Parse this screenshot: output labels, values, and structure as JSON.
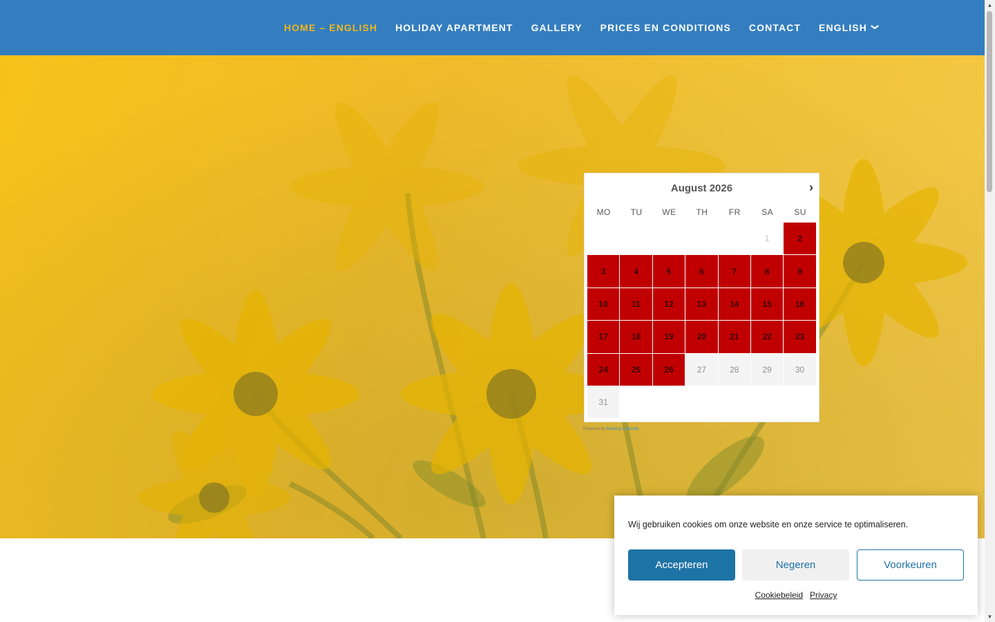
{
  "nav": {
    "items": [
      {
        "label": "HOME – ENGLISH",
        "active": true
      },
      {
        "label": "HOLIDAY APARTMENT",
        "active": false
      },
      {
        "label": "GALLERY",
        "active": false
      },
      {
        "label": "PRICES EN CONDITIONS",
        "active": false
      },
      {
        "label": "CONTACT",
        "active": false
      },
      {
        "label": "ENGLISH",
        "active": false,
        "dropdown": true
      }
    ]
  },
  "calendar": {
    "title": "August 2026",
    "next_icon": "chevron-right-icon",
    "weekdays": [
      "MO",
      "TU",
      "WE",
      "TH",
      "FR",
      "SA",
      "SU"
    ],
    "leading_blanks": 5,
    "days": [
      {
        "d": "1",
        "status": "past"
      },
      {
        "d": "2",
        "status": "booked"
      },
      {
        "d": "3",
        "status": "booked"
      },
      {
        "d": "4",
        "status": "booked"
      },
      {
        "d": "5",
        "status": "booked"
      },
      {
        "d": "6",
        "status": "booked"
      },
      {
        "d": "7",
        "status": "booked"
      },
      {
        "d": "8",
        "status": "booked"
      },
      {
        "d": "9",
        "status": "booked"
      },
      {
        "d": "10",
        "status": "booked"
      },
      {
        "d": "11",
        "status": "booked"
      },
      {
        "d": "12",
        "status": "booked"
      },
      {
        "d": "13",
        "status": "booked"
      },
      {
        "d": "14",
        "status": "booked"
      },
      {
        "d": "15",
        "status": "booked"
      },
      {
        "d": "16",
        "status": "booked"
      },
      {
        "d": "17",
        "status": "booked"
      },
      {
        "d": "18",
        "status": "booked"
      },
      {
        "d": "19",
        "status": "booked"
      },
      {
        "d": "20",
        "status": "booked"
      },
      {
        "d": "21",
        "status": "booked"
      },
      {
        "d": "22",
        "status": "booked"
      },
      {
        "d": "23",
        "status": "booked"
      },
      {
        "d": "24",
        "status": "booked"
      },
      {
        "d": "25",
        "status": "booked"
      },
      {
        "d": "26",
        "status": "booked"
      },
      {
        "d": "27",
        "status": "free"
      },
      {
        "d": "28",
        "status": "free"
      },
      {
        "d": "29",
        "status": "free"
      },
      {
        "d": "30",
        "status": "free"
      },
      {
        "d": "31",
        "status": "free"
      }
    ],
    "powered_prefix": "Powered by ",
    "powered_link": "Booking Calendar"
  },
  "cookie": {
    "message": "Wij gebruiken cookies om onze website en onze service te optimaliseren.",
    "accept_label": "Accepteren",
    "deny_label": "Negeren",
    "prefs_label": "Voorkeuren",
    "policy_link": "Cookiebeleid",
    "privacy_link": "Privacy"
  },
  "colors": {
    "header": "#347ebf",
    "nav_active": "#f2b61b",
    "booked": "#c00000",
    "accept_button": "#1e73a6"
  }
}
